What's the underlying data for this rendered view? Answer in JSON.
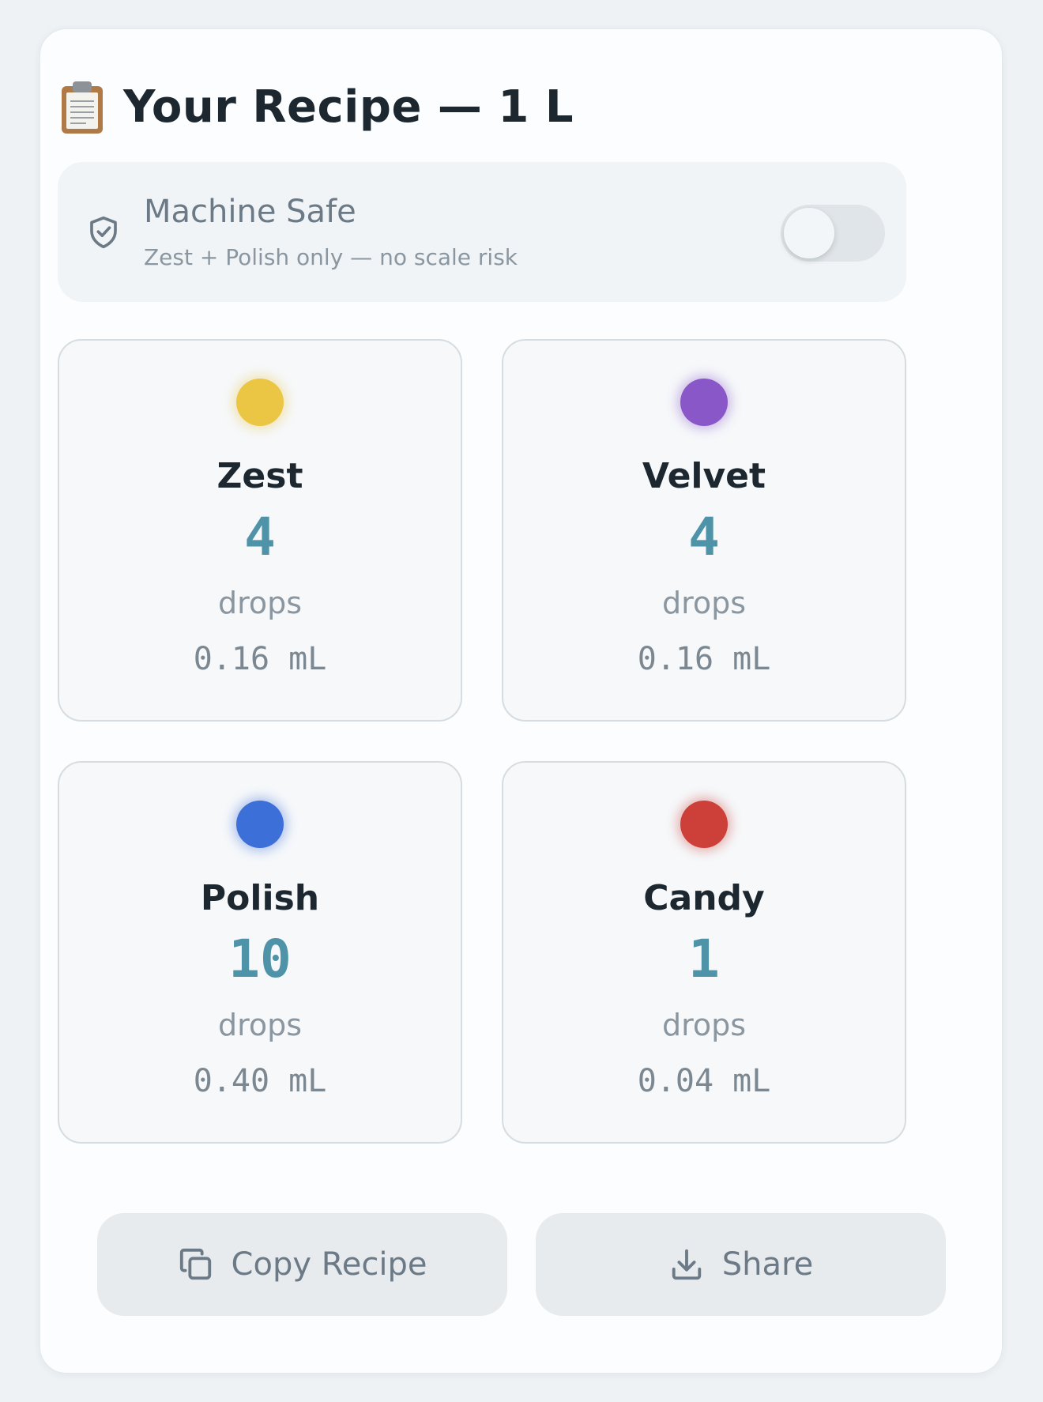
{
  "header": {
    "icon": "clipboard-icon",
    "title": "Your Recipe — 1 L"
  },
  "machine_safe": {
    "icon": "shield-check-icon",
    "title": "Machine Safe",
    "subtitle": "Zest + Polish only — no scale risk",
    "enabled": false
  },
  "flavors": [
    {
      "name": "Zest",
      "count": "4",
      "unit": "drops",
      "ml": "0.16 mL",
      "color": "#ebc645"
    },
    {
      "name": "Velvet",
      "count": "4",
      "unit": "drops",
      "ml": "0.16 mL",
      "color": "#8a57c8"
    },
    {
      "name": "Polish",
      "count": "10",
      "unit": "drops",
      "ml": "0.40 mL",
      "color": "#3d6fd8"
    },
    {
      "name": "Candy",
      "count": "1",
      "unit": "drops",
      "ml": "0.04 mL",
      "color": "#cc4039"
    }
  ],
  "actions": {
    "copy_label": "Copy Recipe",
    "copy_icon": "copy-icon",
    "share_label": "Share",
    "share_icon": "download-icon"
  }
}
